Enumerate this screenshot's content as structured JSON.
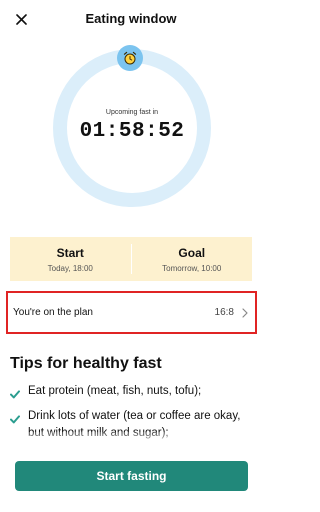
{
  "header": {
    "title": "Eating window",
    "close_icon": "close-icon"
  },
  "ring": {
    "label": "Upcoming fast in",
    "time": "01:58:52",
    "ring_color": "#dbeefa",
    "badge_color": "#7cc4ef",
    "badge_icon": "alarm-clock-icon"
  },
  "schedule": {
    "start_title": "Start",
    "start_value": "Today, 18:00",
    "goal_title": "Goal",
    "goal_value": "Tomorrow, 10:00",
    "card_color": "#fdf1cf"
  },
  "plan": {
    "label": "You're on the plan",
    "value": "16:8",
    "highlight_color": "#e02424"
  },
  "tips": {
    "title": "Tips for healthy fast",
    "items": [
      "Eat protein (meat, fish, nuts, tofu);",
      "Drink lots of water (tea or coffee are okay, but without milk and sugar);"
    ],
    "check_color": "#2a9d8f"
  },
  "action": {
    "start_label": "Start fasting",
    "button_color": "#21887a"
  }
}
